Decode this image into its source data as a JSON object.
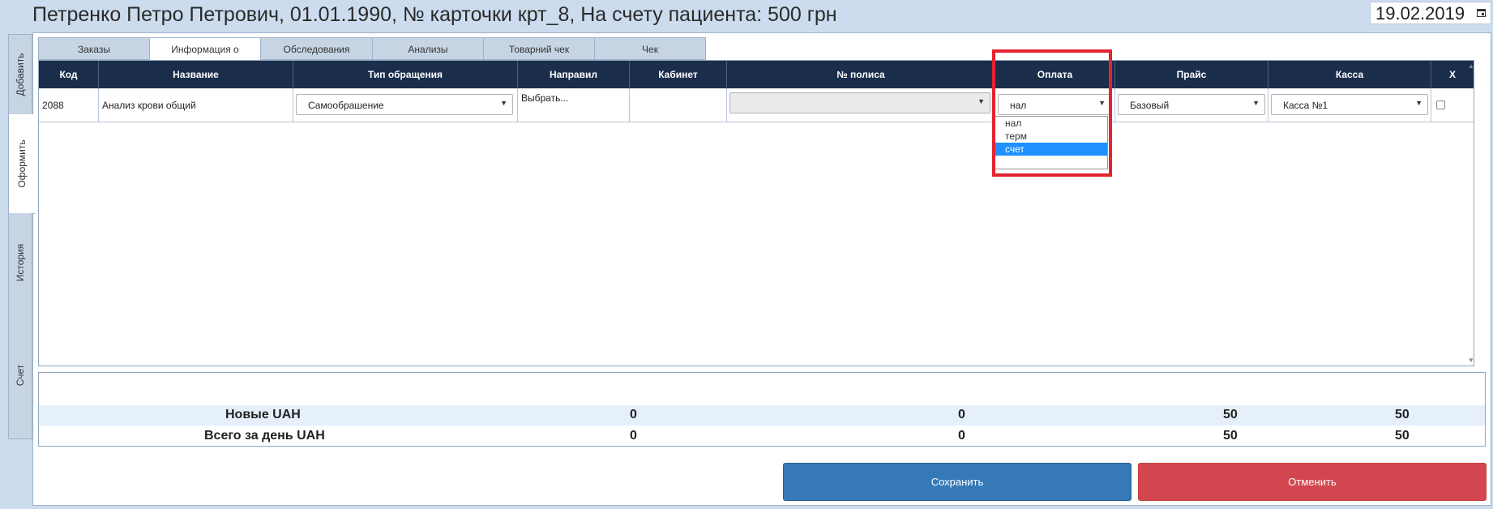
{
  "header": {
    "patient_info": "Петренко Петро Петрович, 01.01.1990, № карточки крт_8, На счету пациента: 500 грн",
    "date": "19.02.2019",
    "date_icon": "calendar-icon"
  },
  "side_tabs": [
    {
      "label": "Добавить",
      "active": false
    },
    {
      "label": "Оформить",
      "active": true
    },
    {
      "label": "История",
      "active": false
    },
    {
      "label": "Счет",
      "active": false
    }
  ],
  "top_tabs": [
    {
      "label": "Заказы",
      "active": false
    },
    {
      "label": "Информация о",
      "active": true
    },
    {
      "label": "Обследования",
      "active": false
    },
    {
      "label": "Анализы",
      "active": false
    },
    {
      "label": "Товарний чек",
      "active": false
    },
    {
      "label": "Чек",
      "active": false
    }
  ],
  "table": {
    "headers": [
      "Код",
      "Название",
      "Тип обращения",
      "Направил",
      "Кабинет",
      "№ полиса",
      "Оплата",
      "Прайс",
      "Касса",
      "X"
    ],
    "rows": [
      {
        "code": "2088",
        "name": "Анализ крови общий",
        "visit_type": "Самообрашение",
        "referrer": "Выбрать...",
        "cabinet": "",
        "policy": "",
        "payment": "нал",
        "price": "Базовый",
        "cashbox": "Касса №1",
        "checked": false
      }
    ]
  },
  "payment_dropdown": {
    "options": [
      "нал",
      "терм",
      "счет"
    ],
    "highlighted": "счет"
  },
  "summary": {
    "rows": [
      {
        "label": "Новые UAH",
        "v1": "0",
        "v2": "0",
        "v3": "50",
        "v4": "50"
      },
      {
        "label": "Всего за день UAH",
        "v1": "0",
        "v2": "0",
        "v3": "50",
        "v4": "50"
      }
    ]
  },
  "buttons": {
    "save": "Сохранить",
    "cancel": "Отменить"
  },
  "colors": {
    "header_bg": "#1a2e4c",
    "save_button": "#357ab7",
    "cancel_button": "#d2474f",
    "highlight": "#e5232e",
    "dropdown_selected": "#1e90ff"
  }
}
